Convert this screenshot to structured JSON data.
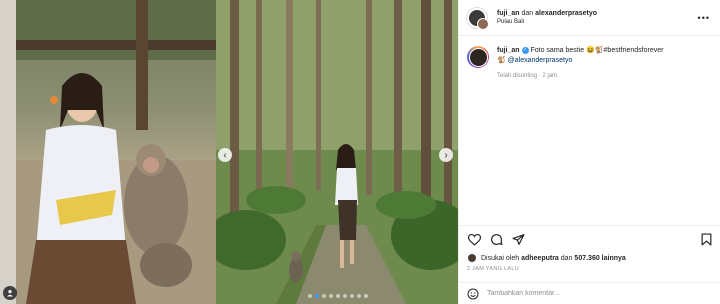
{
  "header": {
    "user1": "fuji_an",
    "connector": "dan",
    "user2": "alexanderprasetyo",
    "location": "Pulau Bali"
  },
  "caption": {
    "username": "fuji_an",
    "text": "Foto sama bestie 😆🐒#bestfriendsforever",
    "mention_line": "🐒 @alexanderprasetyo",
    "edited": "Telah disunting · 2 jam"
  },
  "likes": {
    "prefix": "Disukai oleh",
    "user": "adheeputra",
    "joiner": "dan",
    "count": "507.360 lainnya"
  },
  "post_date": "2 JAM YANG LALU",
  "comment": {
    "placeholder": "Tambahkan komentar...",
    "post_label": "Kirim"
  },
  "carousel": {
    "slides": 9,
    "active": 1
  },
  "icons": [
    "heart-icon",
    "comment-icon",
    "share-icon",
    "bookmark-icon",
    "emoji-icon",
    "more-icon",
    "user-tag-icon"
  ],
  "colors": {
    "link": "#00376b",
    "verified": "#3897f0",
    "muted": "#8e8e8e",
    "post_disabled": "#b2dffc"
  }
}
